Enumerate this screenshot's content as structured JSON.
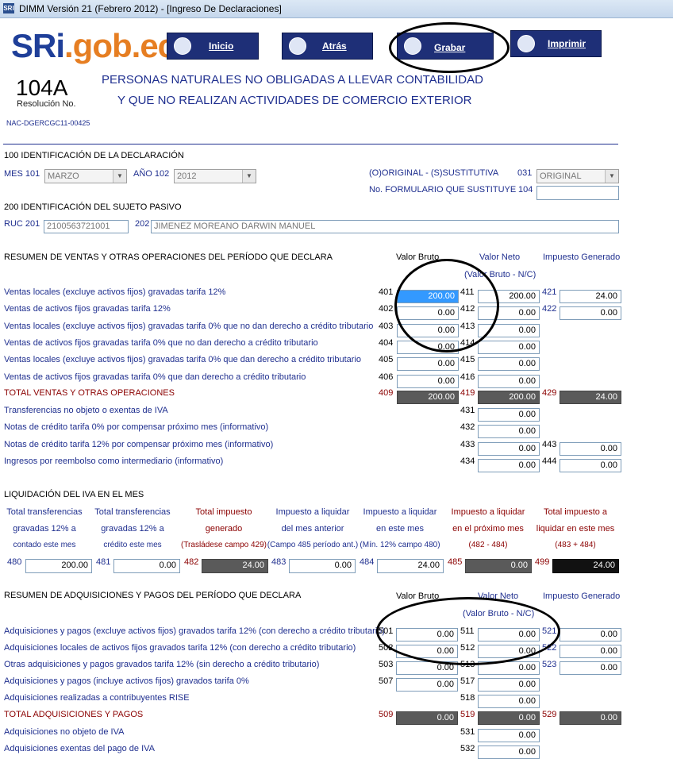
{
  "window": {
    "title": "DIMM Versión 21 (Febrero 2012) - [Ingreso De Declaraciones]",
    "icon": "SRI"
  },
  "logo": {
    "part1": "SRi",
    "part2": ".gob.ec"
  },
  "toolbar": {
    "inicio": "Inicio",
    "atras": "Atrás",
    "grabar": "Grabar",
    "imprimir": "Imprimir"
  },
  "form": {
    "number": "104A",
    "resolucion": "Resolución No.",
    "nac": "NAC-DGERCGC11-00425",
    "heading1": "PERSONAS NATURALES NO OBLIGADAS A LLEVAR CONTABILIDAD",
    "heading2": "Y QUE NO REALIZAN ACTIVIDADES DE COMERCIO EXTERIOR"
  },
  "ident": {
    "section": "100 IDENTIFICACIÓN DE LA DECLARACIÓN",
    "mes_label": "MES",
    "mes_code": "101",
    "mes_value": "MARZO",
    "anio_label": "AÑO",
    "anio_code": "102",
    "anio_value": "2012",
    "orig_label": "(O)ORIGINAL - (S)SUSTITUTIVA",
    "orig_code": "031",
    "orig_value": "ORIGINAL",
    "form_sust_label": "No. FORMULARIO QUE SUSTITUYE",
    "form_sust_code": "104",
    "form_sust_value": ""
  },
  "sujeto": {
    "section": "200 IDENTIFICACIÓN DEL SUJETO PASIVO",
    "ruc_label": "RUC",
    "ruc_code": "201",
    "ruc_value": "2100563721001",
    "name_code": "202",
    "name_value": "JIMENEZ MOREANO DARWIN MANUEL"
  },
  "ventas": {
    "section": "RESUMEN DE VENTAS Y OTRAS OPERACIONES DEL PERÍODO QUE DECLARA",
    "col_bruto": "Valor Bruto",
    "col_neto": "Valor Neto",
    "col_neto_sub": "(Valor Bruto - N/C)",
    "col_imp": "Impuesto Generado",
    "rows": [
      {
        "label": "Ventas locales (excluye activos fijos) gravadas tarifa 12%",
        "c1": "401",
        "v1": "200.00",
        "c2": "411",
        "v2": "200.00",
        "c3": "421",
        "v3": "24.00"
      },
      {
        "label": "Ventas de activos fijos gravadas tarifa 12%",
        "c1": "402",
        "v1": "0.00",
        "c2": "412",
        "v2": "0.00",
        "c3": "422",
        "v3": "0.00"
      },
      {
        "label": "Ventas locales (excluye activos fijos) gravadas tarifa 0% que no dan derecho a crédito tributario",
        "c1": "403",
        "v1": "0.00",
        "c2": "413",
        "v2": "0.00"
      },
      {
        "label": "Ventas de activos fijos gravadas tarifa 0% que no dan derecho a crédito tributario",
        "c1": "404",
        "v1": "0.00",
        "c2": "414",
        "v2": "0.00"
      },
      {
        "label": "Ventas locales (excluye activos fijos) gravadas tarifa 0% que dan derecho a crédito tributario",
        "c1": "405",
        "v1": "0.00",
        "c2": "415",
        "v2": "0.00"
      },
      {
        "label": "Ventas de activos fijos gravadas tarifa 0% que dan derecho a crédito tributario",
        "c1": "406",
        "v1": "0.00",
        "c2": "416",
        "v2": "0.00"
      }
    ],
    "total": {
      "label": "TOTAL VENTAS Y OTRAS OPERACIONES",
      "c1": "409",
      "v1": "200.00",
      "c2": "419",
      "v2": "200.00",
      "c3": "429",
      "v3": "24.00"
    },
    "extra": [
      {
        "label": "Transferencias no objeto o exentas de IVA",
        "c2": "431",
        "v2": "0.00"
      },
      {
        "label": "Notas de crédito tarifa 0% por compensar próximo mes (informativo)",
        "c2": "432",
        "v2": "0.00"
      },
      {
        "label": "Notas de crédito tarifa 12% por compensar próximo mes (informativo)",
        "c2": "433",
        "v2": "0.00",
        "c3": "443",
        "v3": "0.00"
      },
      {
        "label": "Ingresos por reembolso como intermediario (informativo)",
        "c2": "434",
        "v2": "0.00",
        "c3": "444",
        "v3": "0.00"
      }
    ]
  },
  "liquidacion": {
    "section": "LIQUIDACIÓN DEL IVA EN EL MES",
    "cols": [
      {
        "h1": "Total transferencias",
        "h2": "gravadas 12% a",
        "h3": "contado este mes",
        "code": "480",
        "value": "200.00"
      },
      {
        "h1": "Total transferencias",
        "h2": "gravadas 12% a",
        "h3": "crédito este mes",
        "code": "481",
        "value": "0.00"
      },
      {
        "h1": "Total impuesto",
        "h2": "generado",
        "h3": "(Trasládese campo 429)",
        "code": "482",
        "value": "24.00"
      },
      {
        "h1": "Impuesto a liquidar",
        "h2": "del mes anterior",
        "h3": "(Campo 485 período ant.)",
        "code": "483",
        "value": "0.00"
      },
      {
        "h1": "Impuesto a liquidar",
        "h2": "en este mes",
        "h3": "(Mín. 12% campo 480)",
        "code": "484",
        "value": "24.00"
      },
      {
        "h1": "Impuesto a liquidar",
        "h2": "en el próximo mes",
        "h3": "(482 - 484)",
        "code": "485",
        "value": "0.00"
      },
      {
        "h1": "Total impuesto a",
        "h2": "liquidar en este mes",
        "h3": "(483 + 484)",
        "code": "499",
        "value": "24.00"
      }
    ]
  },
  "adquisiciones": {
    "section": "RESUMEN DE ADQUISICIONES Y PAGOS DEL PERÍODO QUE DECLARA",
    "col_bruto": "Valor Bruto",
    "col_neto": "Valor Neto",
    "col_neto_sub": "(Valor Bruto - N/C)",
    "col_imp": "Impuesto Generado",
    "rows": [
      {
        "label": "Adquisiciones y pagos (excluye activos fijos) gravados tarifa 12% (con derecho a crédito tributario)",
        "c1": "501",
        "v1": "0.00",
        "c2": "511",
        "v2": "0.00",
        "c3": "521",
        "v3": "0.00"
      },
      {
        "label": "Adquisiciones locales de activos fijos gravados tarifa 12% (con derecho a crédito tributario)",
        "c1": "502",
        "v1": "0.00",
        "c2": "512",
        "v2": "0.00",
        "c3": "522",
        "v3": "0.00"
      },
      {
        "label": "Otras adquisiciones y pagos gravados tarifa 12% (sin derecho a crédito tributario)",
        "c1": "503",
        "v1": "0.00",
        "c2": "513",
        "v2": "0.00",
        "c3": "523",
        "v3": "0.00"
      },
      {
        "label": "Adquisiciones y pagos (incluye activos fijos) gravados tarifa 0%",
        "c1": "507",
        "v1": "0.00",
        "c2": "517",
        "v2": "0.00"
      },
      {
        "label": "Adquisiciones realizadas a contribuyentes RISE",
        "c2": "518",
        "v2": "0.00"
      }
    ],
    "total": {
      "label": "TOTAL ADQUISICIONES Y PAGOS",
      "c1": "509",
      "v1": "0.00",
      "c2": "519",
      "v2": "0.00",
      "c3": "529",
      "v3": "0.00"
    },
    "extra": [
      {
        "label": "Adquisiciones no objeto de IVA",
        "c2": "531",
        "v2": "0.00"
      },
      {
        "label": "Adquisiciones exentas del pago de IVA",
        "c2": "532",
        "v2": "0.00"
      }
    ]
  }
}
